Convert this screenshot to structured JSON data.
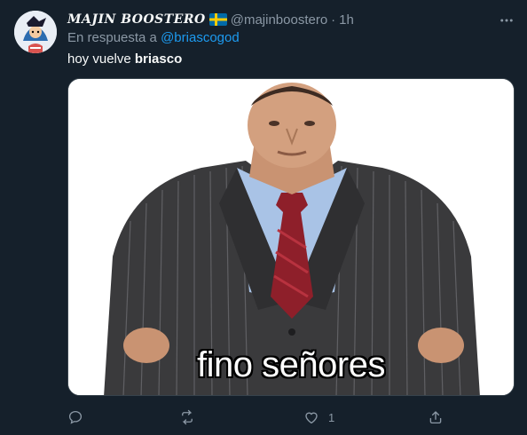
{
  "author": {
    "display_name": "MAJIN BOOSTERO",
    "handle": "@majinboostero",
    "time": "1h",
    "flag": "Sweden flag",
    "separator": "·"
  },
  "reply_context": {
    "prefix": "En respuesta a",
    "mention": "@briascogod"
  },
  "tweet": {
    "text_plain": "hoy vuelve",
    "text_bold": "briasco"
  },
  "media": {
    "caption": "fino señores",
    "description": "meme-image"
  },
  "actions": {
    "reply_icon": "reply-icon",
    "retweet_icon": "retweet-icon",
    "like_icon": "like-icon",
    "like_count": "1",
    "share_icon": "share-icon"
  },
  "colors": {
    "background": "#15202b",
    "accent": "#1d9bf0",
    "muted": "#8b98a5",
    "text": "#f7f9f9"
  }
}
